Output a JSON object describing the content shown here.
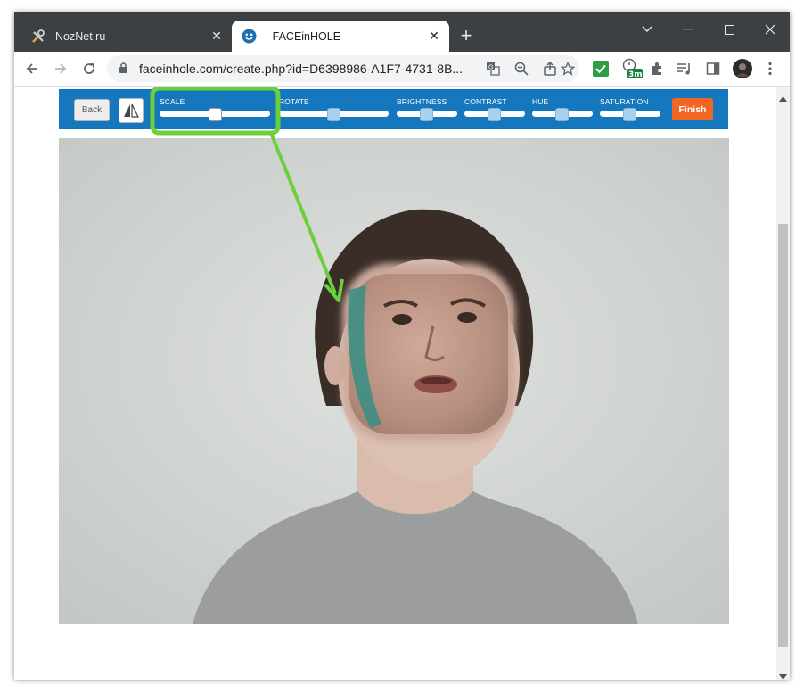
{
  "browser": {
    "tabs": [
      {
        "title": "NozNet.ru",
        "close": "✕"
      },
      {
        "title": "- FACEinHOLE",
        "close": "✕"
      }
    ],
    "new_tab": "+",
    "url": "faceinhole.com/create.php?id=D6398986-A1F7-4731-8B...",
    "extension_badge": "3m"
  },
  "editor": {
    "back_label": "Back",
    "finish_label": "Finish",
    "sliders": [
      {
        "label": "SCALE",
        "value": 0.5
      },
      {
        "label": "ROTATE",
        "value": 0.5
      },
      {
        "label": "BRIGHTNESS",
        "value": 0.5
      },
      {
        "label": "CONTRAST",
        "value": 0.5
      },
      {
        "label": "HUE",
        "value": 0.5
      },
      {
        "label": "SATURATION",
        "value": 0.5
      }
    ]
  },
  "colors": {
    "toolbar_blue": "#1577be",
    "finish_orange": "#f26522",
    "highlight_green": "#6ccf3c"
  }
}
